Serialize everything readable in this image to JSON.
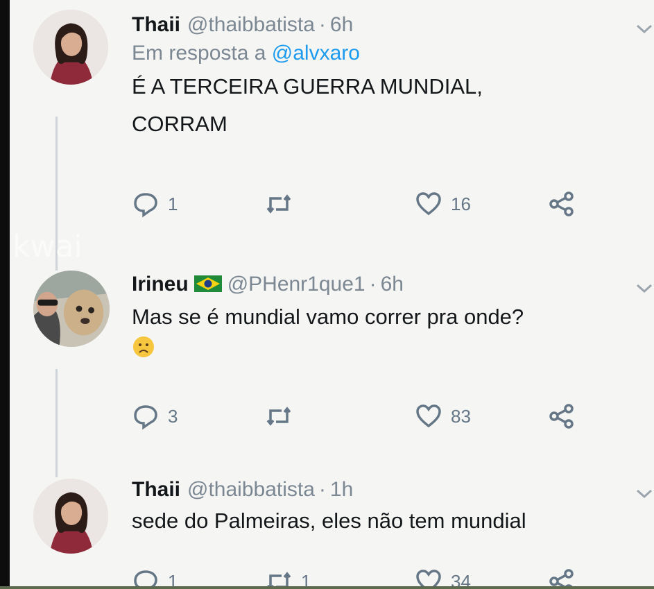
{
  "tweets": [
    {
      "name": "Thaii",
      "handle": "@thaibbatista",
      "time": "6h",
      "reply_prefix": "Em resposta a",
      "reply_mention": "@alvxaro",
      "text_line1": "É A TERCEIRA GUERRA MUNDIAL,",
      "text_line2": "CORRAM",
      "replies": "1",
      "retweets": "",
      "likes": "16"
    },
    {
      "name": "Irineu",
      "flag": "brazil-flag",
      "handle": "@PHenr1que1",
      "time": "6h",
      "text_line1": "Mas se é mundial vamo correr pra onde?",
      "emoji": "worried-face",
      "replies": "3",
      "retweets": "",
      "likes": "83"
    },
    {
      "name": "Thaii",
      "handle": "@thaibbatista",
      "time": "1h",
      "text_line1": "sede do Palmeiras, eles não tem mundial",
      "replies": "1",
      "retweets": "1",
      "likes": "34"
    }
  ],
  "separator": "·",
  "watermark": "kwai",
  "colors": {
    "background": "#f5f5f3",
    "text": "#14171a",
    "muted": "#7b8792",
    "link": "#1d9bf0",
    "thread_line": "#cfd4d8"
  }
}
